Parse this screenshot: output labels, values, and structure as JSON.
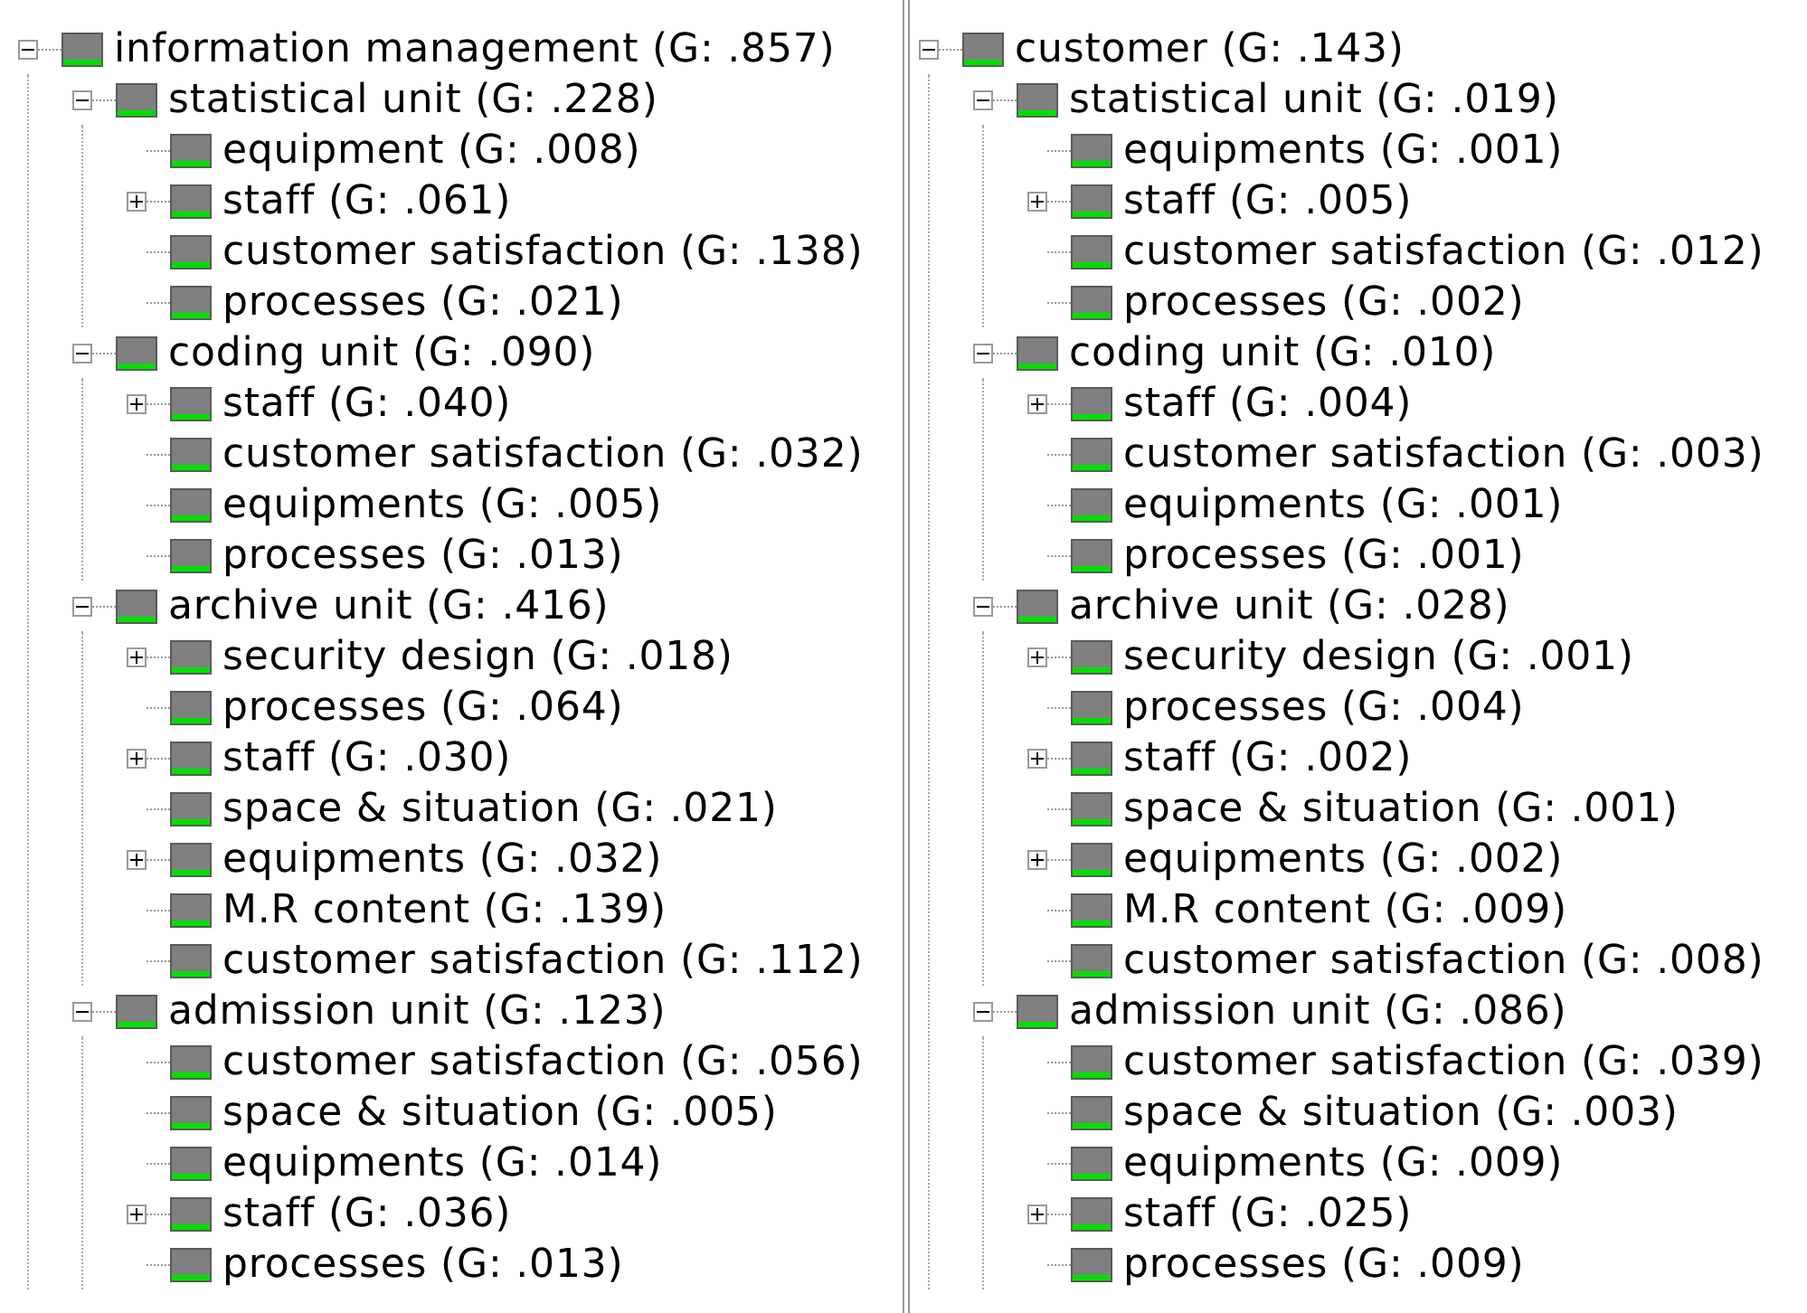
{
  "panes": [
    {
      "nodes": [
        {
          "label": "information management (G: .857)",
          "kind": "branch",
          "expanded": true,
          "children": [
            {
              "label": "statistical unit (G: .228)",
              "kind": "branch",
              "expanded": true,
              "children": [
                {
                  "label": "equipment (G: .008)",
                  "kind": "leaf"
                },
                {
                  "label": "staff (G: .061)",
                  "kind": "branch",
                  "expanded": false
                },
                {
                  "label": "customer satisfaction (G: .138)",
                  "kind": "leaf"
                },
                {
                  "label": "processes (G: .021)",
                  "kind": "leaf"
                }
              ]
            },
            {
              "label": "coding unit (G: .090)",
              "kind": "branch",
              "expanded": true,
              "children": [
                {
                  "label": "staff (G: .040)",
                  "kind": "branch",
                  "expanded": false
                },
                {
                  "label": "customer satisfaction (G: .032)",
                  "kind": "leaf"
                },
                {
                  "label": "equipments (G: .005)",
                  "kind": "leaf"
                },
                {
                  "label": "processes (G: .013)",
                  "kind": "leaf"
                }
              ]
            },
            {
              "label": "archive unit (G: .416)",
              "kind": "branch",
              "expanded": true,
              "children": [
                {
                  "label": "security design (G: .018)",
                  "kind": "branch",
                  "expanded": false
                },
                {
                  "label": "processes (G: .064)",
                  "kind": "leaf"
                },
                {
                  "label": "staff (G: .030)",
                  "kind": "branch",
                  "expanded": false
                },
                {
                  "label": "space & situation (G: .021)",
                  "kind": "leaf"
                },
                {
                  "label": "equipments (G: .032)",
                  "kind": "branch",
                  "expanded": false
                },
                {
                  "label": "M.R content (G: .139)",
                  "kind": "leaf"
                },
                {
                  "label": "customer satisfaction (G: .112)",
                  "kind": "leaf"
                }
              ]
            },
            {
              "label": "admission unit (G: .123)",
              "kind": "branch",
              "expanded": true,
              "children": [
                {
                  "label": "customer satisfaction (G: .056)",
                  "kind": "leaf"
                },
                {
                  "label": "space & situation (G: .005)",
                  "kind": "leaf"
                },
                {
                  "label": "equipments (G: .014)",
                  "kind": "leaf"
                },
                {
                  "label": "staff (G: .036)",
                  "kind": "branch",
                  "expanded": false
                },
                {
                  "label": "processes (G: .013)",
                  "kind": "leaf"
                }
              ]
            }
          ]
        }
      ]
    },
    {
      "nodes": [
        {
          "label": "customer (G: .143)",
          "kind": "branch",
          "expanded": true,
          "children": [
            {
              "label": "statistical unit (G: .019)",
              "kind": "branch",
              "expanded": true,
              "children": [
                {
                  "label": "equipments (G: .001)",
                  "kind": "leaf"
                },
                {
                  "label": "staff (G: .005)",
                  "kind": "branch",
                  "expanded": false
                },
                {
                  "label": "customer satisfaction (G: .012)",
                  "kind": "leaf"
                },
                {
                  "label": "processes (G: .002)",
                  "kind": "leaf"
                }
              ]
            },
            {
              "label": "coding unit (G: .010)",
              "kind": "branch",
              "expanded": true,
              "children": [
                {
                  "label": "staff (G: .004)",
                  "kind": "branch",
                  "expanded": false
                },
                {
                  "label": "customer satisfaction (G: .003)",
                  "kind": "leaf"
                },
                {
                  "label": "equipments (G: .001)",
                  "kind": "leaf"
                },
                {
                  "label": "processes (G: .001)",
                  "kind": "leaf"
                }
              ]
            },
            {
              "label": "archive unit (G: .028)",
              "kind": "branch",
              "expanded": true,
              "children": [
                {
                  "label": "security design (G: .001)",
                  "kind": "branch",
                  "expanded": false
                },
                {
                  "label": "processes (G: .004)",
                  "kind": "leaf"
                },
                {
                  "label": "staff (G: .002)",
                  "kind": "branch",
                  "expanded": false
                },
                {
                  "label": "space & situation (G: .001)",
                  "kind": "leaf"
                },
                {
                  "label": "equipments (G: .002)",
                  "kind": "branch",
                  "expanded": false
                },
                {
                  "label": "M.R content (G: .009)",
                  "kind": "leaf"
                },
                {
                  "label": "customer satisfaction (G: .008)",
                  "kind": "leaf"
                }
              ]
            },
            {
              "label": "admission unit (G: .086)",
              "kind": "branch",
              "expanded": true,
              "children": [
                {
                  "label": "customer satisfaction (G: .039)",
                  "kind": "leaf"
                },
                {
                  "label": "space & situation (G: .003)",
                  "kind": "leaf"
                },
                {
                  "label": "equipments (G: .009)",
                  "kind": "leaf"
                },
                {
                  "label": "staff (G: .025)",
                  "kind": "branch",
                  "expanded": false
                },
                {
                  "label": "processes (G: .009)",
                  "kind": "leaf"
                }
              ]
            }
          ]
        }
      ]
    }
  ]
}
